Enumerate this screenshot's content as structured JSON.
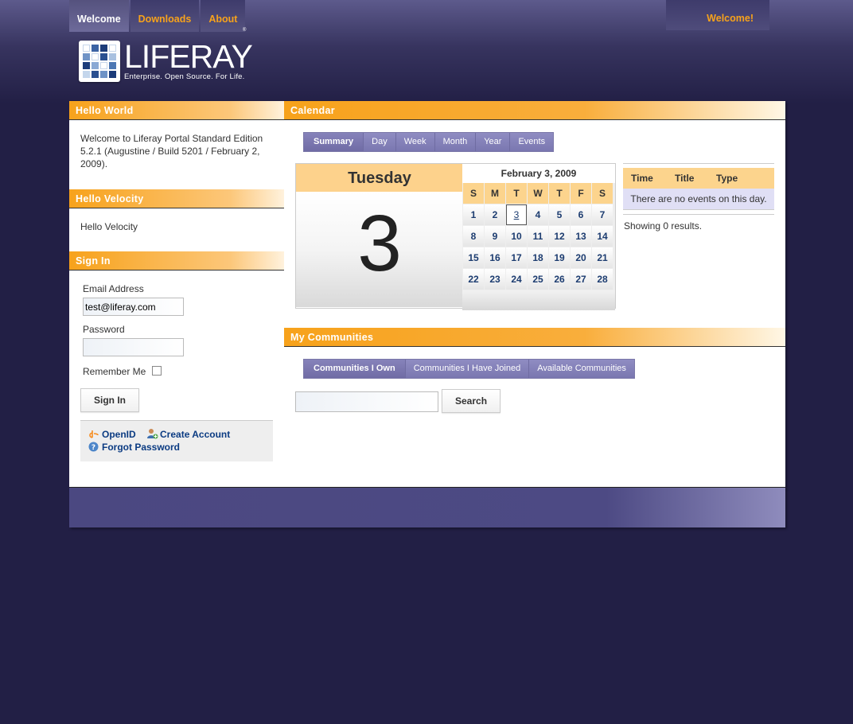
{
  "nav": {
    "items": [
      {
        "label": "Welcome",
        "active": true
      },
      {
        "label": "Downloads",
        "active": false
      },
      {
        "label": "About",
        "active": false
      }
    ],
    "welcome_link": "Welcome!"
  },
  "logo": {
    "word": "LIFERAY",
    "tagline": "Enterprise. Open Source. For Life.",
    "trademark": "®"
  },
  "hello_world": {
    "title": "Hello World",
    "text": "Welcome to Liferay Portal Standard Edition 5.2.1 (Augustine / Build 5201 / February 2, 2009)."
  },
  "hello_velocity": {
    "title": "Hello Velocity",
    "text": "Hello Velocity"
  },
  "sign_in": {
    "title": "Sign In",
    "email_label": "Email Address",
    "email_value": "test@liferay.com",
    "password_label": "Password",
    "password_value": "",
    "remember_label": "Remember Me",
    "remember_checked": false,
    "button_label": "Sign In",
    "openid_label": "OpenID",
    "create_account_label": "Create Account",
    "forgot_password_label": "Forgot Password"
  },
  "calendar": {
    "title": "Calendar",
    "tabs": [
      "Summary",
      "Day",
      "Week",
      "Month",
      "Year",
      "Events"
    ],
    "selected_tab": "Summary",
    "day_name": "Tuesday",
    "day_number": "3",
    "month_label": "February 3, 2009",
    "weekday_headers": [
      "S",
      "M",
      "T",
      "W",
      "T",
      "F",
      "S"
    ],
    "weeks": [
      [
        "1",
        "2",
        "3",
        "4",
        "5",
        "6",
        "7"
      ],
      [
        "8",
        "9",
        "10",
        "11",
        "12",
        "13",
        "14"
      ],
      [
        "15",
        "16",
        "17",
        "18",
        "19",
        "20",
        "21"
      ],
      [
        "22",
        "23",
        "24",
        "25",
        "26",
        "27",
        "28"
      ]
    ],
    "today": "3",
    "events_columns": [
      "Time",
      "Title",
      "Type"
    ],
    "no_events_text": "There are no events on this day.",
    "results_text": "Showing 0 results."
  },
  "communities": {
    "title": "My Communities",
    "tabs": [
      "Communities I Own",
      "Communities I Have Joined",
      "Available Communities"
    ],
    "selected_tab": "Communities I Own",
    "search_value": "",
    "search_button": "Search"
  },
  "colors": {
    "background": "#221f45",
    "accent_orange": "#f7a21b",
    "tab_purple": "#7a77b0",
    "link_blue": "#0b3b82"
  }
}
